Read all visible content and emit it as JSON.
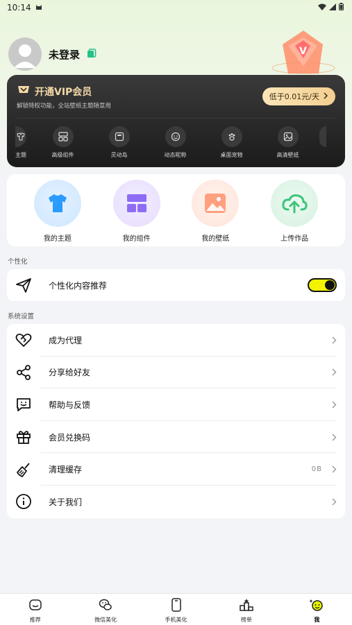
{
  "status_bar": {
    "time": "10:14"
  },
  "profile": {
    "username": "未登录"
  },
  "vip": {
    "title": "开通VIP会员",
    "description": "解锁特权功能，全站壁纸主题随意用",
    "button_label": "低于0.01元/天",
    "features": [
      {
        "label": "主题",
        "icon": "shirt-icon"
      },
      {
        "label": "高级组件",
        "icon": "widget-icon"
      },
      {
        "label": "灵动岛",
        "icon": "island-icon"
      },
      {
        "label": "动态昵称",
        "icon": "smile-icon"
      },
      {
        "label": "桌面宠物",
        "icon": "paw-icon"
      },
      {
        "label": "高清壁纸",
        "icon": "image-icon"
      }
    ]
  },
  "works": [
    {
      "label": "我的主题",
      "icon": "tshirt-icon",
      "color": "#2a9bff",
      "bg": "#e3f1ff"
    },
    {
      "label": "我的组件",
      "icon": "widget-grid-icon",
      "color": "#8e6cf5",
      "bg": "#efe9ff"
    },
    {
      "label": "我的壁纸",
      "icon": "picture-icon",
      "color": "#ff8a63",
      "bg": "#fff0ea"
    },
    {
      "label": "上传作品",
      "icon": "cloud-upload-icon",
      "color": "#3ec47a",
      "bg": "#e6f7ec"
    }
  ],
  "personalization": {
    "section_title": "个性化",
    "item_label": "个性化内容推荐",
    "toggle_on": true,
    "toggle_color": "#f3f300"
  },
  "system": {
    "section_title": "系统设置",
    "items": [
      {
        "label": "成为代理",
        "icon": "heart-handshake-icon",
        "value": ""
      },
      {
        "label": "分享给好友",
        "icon": "share-icon",
        "value": ""
      },
      {
        "label": "帮助与反馈",
        "icon": "feedback-icon",
        "value": ""
      },
      {
        "label": "会员兑换码",
        "icon": "gift-icon",
        "value": ""
      },
      {
        "label": "清理缓存",
        "icon": "broom-icon",
        "value": "0B"
      },
      {
        "label": "关于我们",
        "icon": "info-icon",
        "value": ""
      }
    ]
  },
  "bottom_nav": [
    {
      "label": "推荐",
      "icon": "home-smile-icon",
      "active": false
    },
    {
      "label": "微信美化",
      "icon": "wechat-icon",
      "active": false
    },
    {
      "label": "手机美化",
      "icon": "phone-icon",
      "active": false
    },
    {
      "label": "榜单",
      "icon": "podium-icon",
      "active": false
    },
    {
      "label": "我",
      "icon": "me-face-icon",
      "active": true
    }
  ]
}
